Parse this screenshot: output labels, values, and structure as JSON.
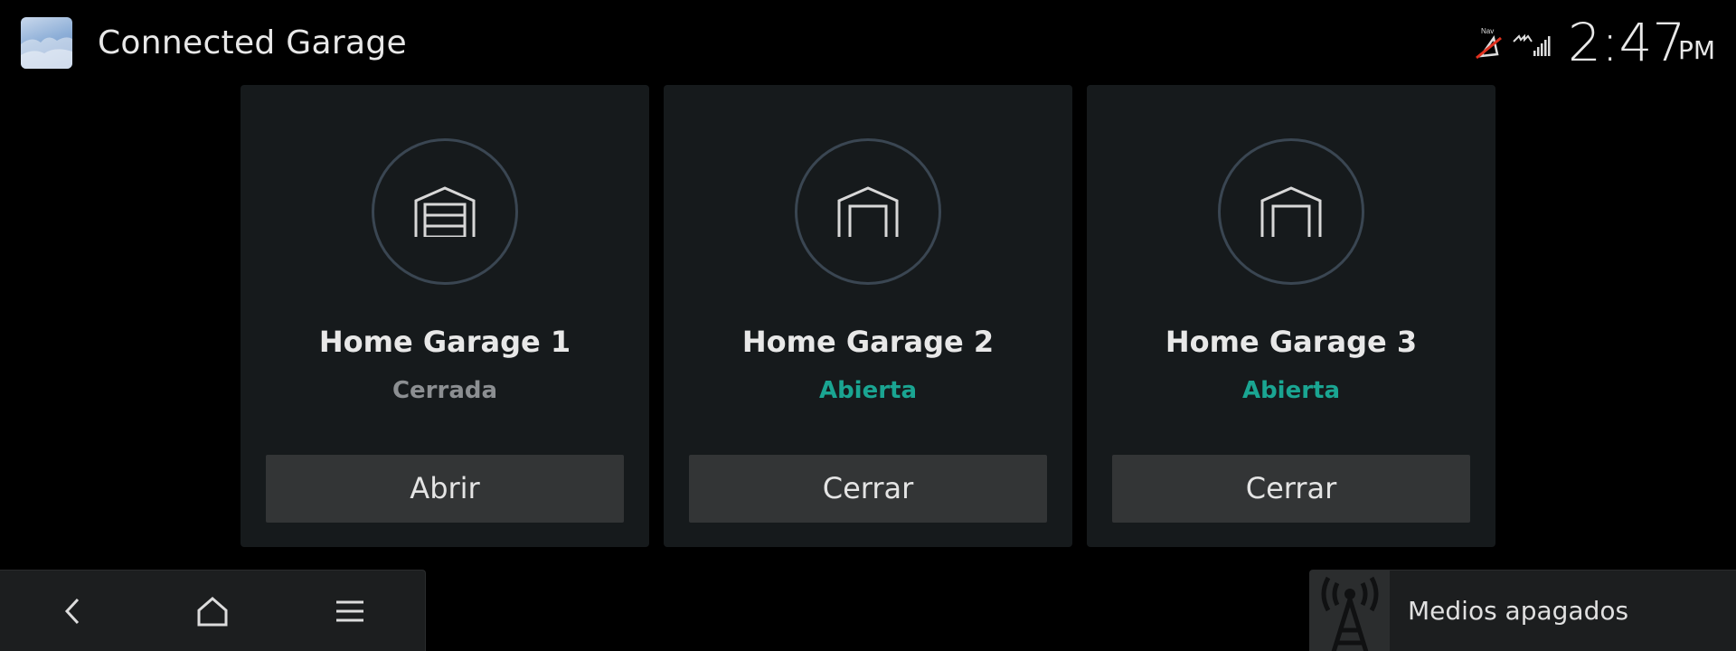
{
  "app": {
    "title": "Connected Garage",
    "icon": "connected-garage-app-icon"
  },
  "status_bar": {
    "nav_label": "Nav",
    "nav_icon": "nav-off-icon",
    "brand_signal_icon": "brand-signal-icon",
    "time": "2:47",
    "ampm": "PM"
  },
  "colors": {
    "background": "#000000",
    "card": "#161a1c",
    "button": "#333536",
    "status_open": "#1aa592",
    "status_closed": "#8c8f92",
    "circle_border": "#3a4652"
  },
  "garages": [
    {
      "name": "Home Garage 1",
      "status": "Cerrada",
      "state": "closed",
      "action": "Abrir",
      "icon": "garage-closed-icon"
    },
    {
      "name": "Home Garage 2",
      "status": "Abierta",
      "state": "open",
      "action": "Cerrar",
      "icon": "garage-open-icon"
    },
    {
      "name": "Home Garage 3",
      "status": "Abierta",
      "state": "open",
      "action": "Cerrar",
      "icon": "garage-open-icon"
    }
  ],
  "bottom_nav": {
    "items": [
      {
        "icon": "back-icon"
      },
      {
        "icon": "home-icon"
      },
      {
        "icon": "menu-icon"
      }
    ]
  },
  "media": {
    "icon": "radio-tower-icon",
    "label": "Medios apagados"
  }
}
